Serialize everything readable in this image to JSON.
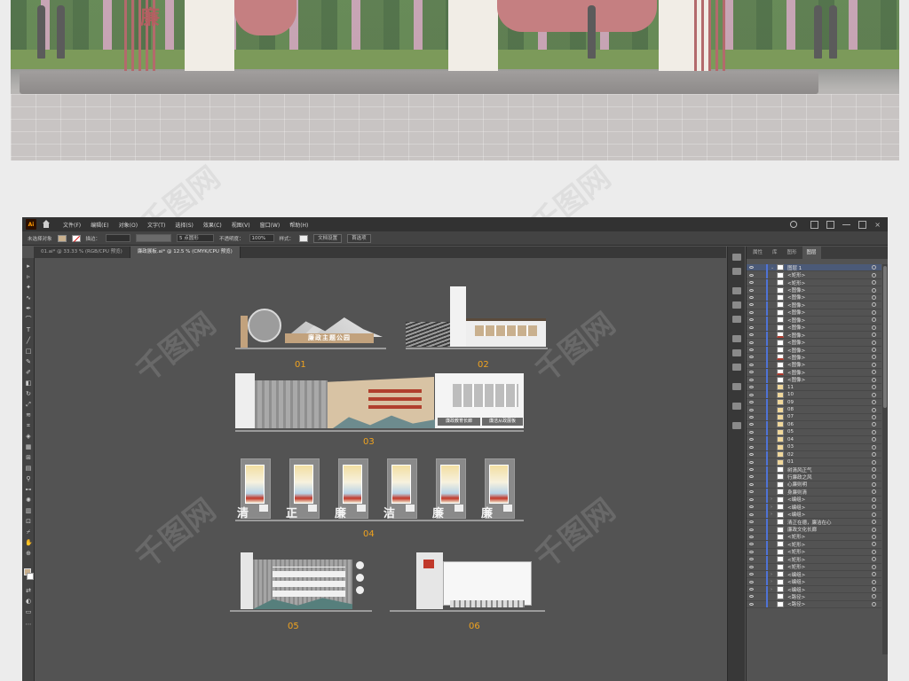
{
  "render": {
    "sign_chars": [
      "廉"
    ]
  },
  "watermark": "千图网",
  "app": {
    "logo": "Ai",
    "menu": [
      "文件(F)",
      "编辑(E)",
      "对象(O)",
      "文字(T)",
      "选择(S)",
      "效果(C)",
      "视图(V)",
      "窗口(W)",
      "帮助(H)"
    ],
    "control_bar": {
      "no_selection": "未选择对象",
      "stroke_label": "描边：",
      "brush_field": "5 点圆形",
      "opacity_label": "不透明度：",
      "opacity_value": "100%",
      "style_label": "样式：",
      "doc_setup": "文档设置",
      "prefs": "首选项"
    },
    "tabs": [
      {
        "label": "01.ai* @ 33.33 % (RGB/CPU 预览)",
        "active": false
      },
      {
        "label": "廉政展板.ai* @ 12.5 % (CMYK/CPU 预览)",
        "active": true
      }
    ],
    "colors": {
      "accent": "#f0a31f",
      "ui_dark": "#323232",
      "canvas": "#535353",
      "layer_blue": "#4f73d6"
    }
  },
  "layers_panel": {
    "tabs": [
      "属性",
      "库",
      "图形",
      "图层"
    ],
    "active_tab": "图层",
    "rows": [
      {
        "name": "图层 1",
        "thumb": "white",
        "top": true
      },
      {
        "name": "<矩形>",
        "thumb": "white"
      },
      {
        "name": "<矩形>",
        "thumb": "white"
      },
      {
        "name": "<图像>",
        "thumb": "white"
      },
      {
        "name": "<图像>",
        "thumb": "white"
      },
      {
        "name": "<图像>",
        "thumb": "white"
      },
      {
        "name": "<图像>",
        "thumb": "white"
      },
      {
        "name": "<图像>",
        "thumb": "white"
      },
      {
        "name": "<图像>",
        "thumb": "white"
      },
      {
        "name": "<图像>",
        "thumb": "red"
      },
      {
        "name": "<图像>",
        "thumb": "white"
      },
      {
        "name": "<图像>",
        "thumb": "white"
      },
      {
        "name": "<图像>",
        "thumb": "red"
      },
      {
        "name": "<图像>",
        "thumb": "white"
      },
      {
        "name": "<图像>",
        "thumb": "red"
      },
      {
        "name": "<图像>",
        "thumb": "white"
      },
      {
        "name": "11",
        "thumb": "folder"
      },
      {
        "name": "10",
        "thumb": "folder"
      },
      {
        "name": "09",
        "thumb": "folder"
      },
      {
        "name": "08",
        "thumb": "folder"
      },
      {
        "name": "07",
        "thumb": "folder"
      },
      {
        "name": "06",
        "thumb": "folder"
      },
      {
        "name": "05",
        "thumb": "folder"
      },
      {
        "name": "04",
        "thumb": "folder"
      },
      {
        "name": "03",
        "thumb": "folder"
      },
      {
        "name": "02",
        "thumb": "folder"
      },
      {
        "name": "01",
        "thumb": "folder"
      },
      {
        "name": "树清风正气",
        "thumb": "white"
      },
      {
        "name": "行廉政之风",
        "thumb": "white"
      },
      {
        "name": "心廉则明",
        "thumb": "white"
      },
      {
        "name": "身廉则清",
        "thumb": "white"
      },
      {
        "name": "<编组>",
        "thumb": "white",
        "expand": true
      },
      {
        "name": "<编组>",
        "thumb": "white",
        "expand": true
      },
      {
        "name": "<编组>",
        "thumb": "white",
        "expand": true
      },
      {
        "name": "清正在德，廉洁在心",
        "thumb": "white"
      },
      {
        "name": "廉政文化长廊",
        "thumb": "white"
      },
      {
        "name": "<矩形>",
        "thumb": "white"
      },
      {
        "name": "<矩形>",
        "thumb": "white"
      },
      {
        "name": "<矩形>",
        "thumb": "white"
      },
      {
        "name": "<矩形>",
        "thumb": "white"
      },
      {
        "name": "<矩形>",
        "thumb": "white"
      },
      {
        "name": "<编组>",
        "thumb": "white",
        "expand": true
      },
      {
        "name": "<编组>",
        "thumb": "white",
        "expand": true
      },
      {
        "name": "<编组>",
        "thumb": "white",
        "expand": true
      },
      {
        "name": "<路径>",
        "thumb": "white"
      },
      {
        "name": "<路径>",
        "thumb": "white"
      }
    ]
  },
  "artboards": {
    "labels": [
      "01",
      "02",
      "03",
      "04",
      "05",
      "06"
    ],
    "board01_sign": "廉政主题公园",
    "board03_signs": [
      "廉政教育长廊",
      "廉洁从政展板"
    ],
    "board04_chars": [
      "清",
      "正",
      "廉",
      "洁",
      "廉",
      "廉"
    ]
  }
}
